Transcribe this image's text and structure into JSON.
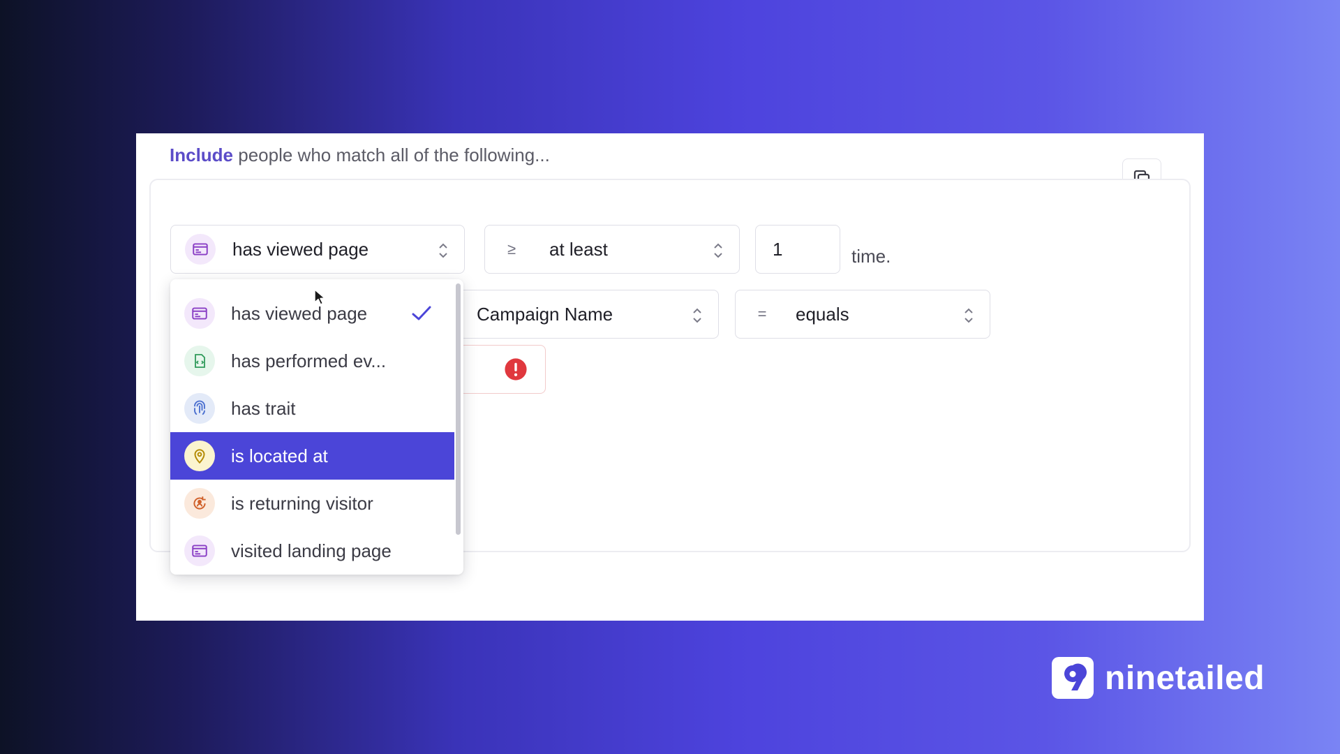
{
  "heading": {
    "accent": "Include",
    "rest": " people who match all of the following..."
  },
  "row1": {
    "condition_select": {
      "label": "has viewed page",
      "icon": "page-icon"
    },
    "operator_select": {
      "symbol": "≥",
      "label": "at least"
    },
    "count_input": {
      "value": "1"
    },
    "suffix": "time."
  },
  "row2": {
    "property_select": {
      "label": "Campaign Name"
    },
    "comparison_select": {
      "symbol": "=",
      "label": "equals"
    }
  },
  "error_field": {
    "icon": "error-icon",
    "color": "#e0383e"
  },
  "dropdown": {
    "items": [
      {
        "label": "has viewed page",
        "icon": "page-icon",
        "selected": true
      },
      {
        "label": "has performed ev...",
        "icon": "event-icon"
      },
      {
        "label": "has trait",
        "icon": "fingerprint-icon"
      },
      {
        "label": "is located at",
        "icon": "location-pin-icon",
        "highlighted": true
      },
      {
        "label": "is returning visitor",
        "icon": "returning-visitor-icon"
      },
      {
        "label": "visited landing page",
        "icon": "page-icon"
      }
    ]
  },
  "colors": {
    "accent": "#5b4cc8",
    "highlight": "#4b45d8",
    "check": "#4b45d8"
  },
  "brand": {
    "name": "ninetailed",
    "icon": "ninetailed-logo"
  }
}
